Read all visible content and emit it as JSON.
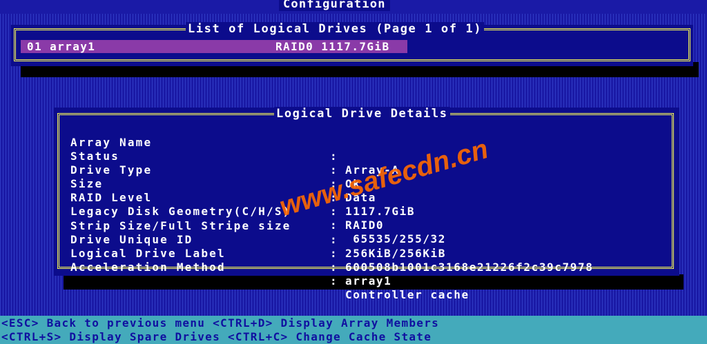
{
  "header": {
    "title": "Configuration"
  },
  "logical_drives_panel": {
    "title": "List of Logical Drives (Page 1 of 1)",
    "rows": [
      {
        "name": "01 array1",
        "raid": "RAID0 1117.7GiB"
      }
    ]
  },
  "details_panel": {
    "title": "Logical Drive Details",
    "separator": ":",
    "fields": [
      {
        "label": "Array Name",
        "value": "Array-A"
      },
      {
        "label": "Status",
        "value": "Ok"
      },
      {
        "label": "Drive Type",
        "value": "Data"
      },
      {
        "label": "Size",
        "value": "1117.7GiB"
      },
      {
        "label": "RAID Level",
        "value": "RAID0"
      },
      {
        "label": "Legacy Disk Geometry(C/H/S)",
        "value": " 65535/255/32"
      },
      {
        "label": "Strip Size/Full Stripe size",
        "value": "256KiB/256KiB"
      },
      {
        "label": "Drive Unique ID",
        "value": "600508b1001c3168e21226f2c39c7978"
      },
      {
        "label": "Logical Drive Label",
        "value": "array1"
      },
      {
        "label": "Acceleration Method",
        "value": "Controller cache"
      }
    ]
  },
  "footer": {
    "line1": "<ESC> Back to previous menu <CTRL+D> Display Array Members",
    "line2": "<CTRL+S> Display Spare Drives <CTRL+C> Change Cache State"
  },
  "watermark": {
    "text": "www.safecdn.cn"
  }
}
